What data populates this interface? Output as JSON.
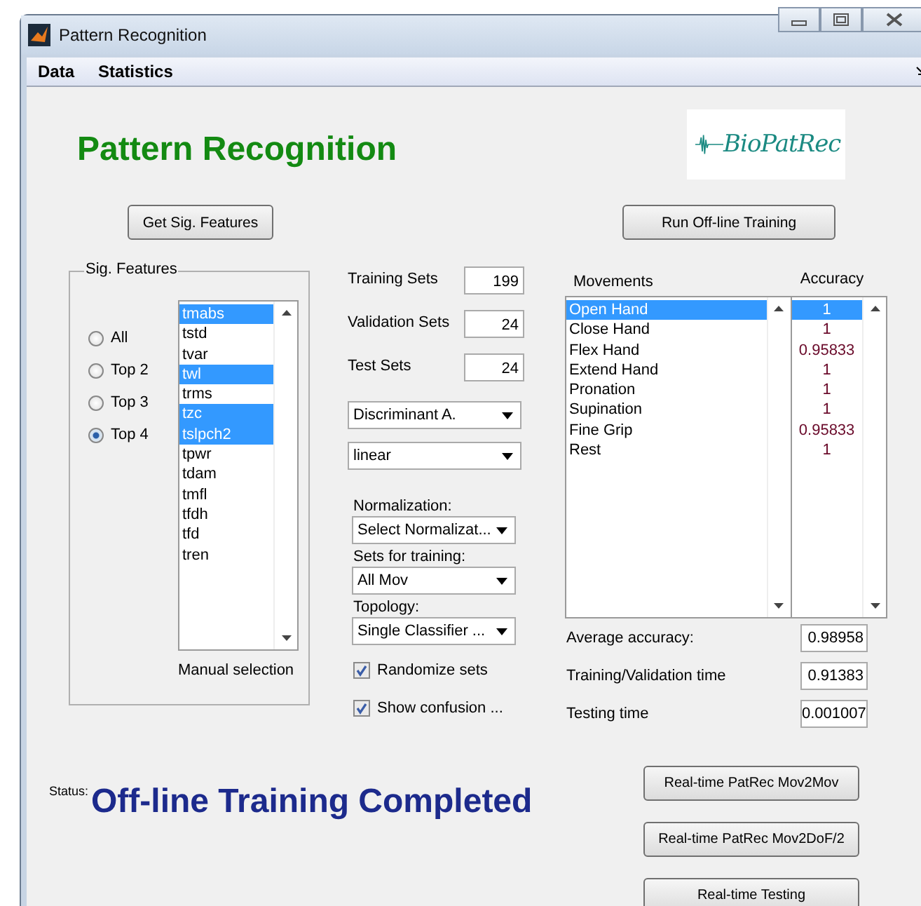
{
  "window": {
    "title": "Pattern Recognition"
  },
  "menu": [
    {
      "label": "Data"
    },
    {
      "label": "Statistics"
    }
  ],
  "header": {
    "title": "Pattern Recognition",
    "logo": "BioPatRec"
  },
  "top_buttons": [
    {
      "label": "Get Sig. Features"
    },
    {
      "label": "Run Off-line Training"
    }
  ],
  "sig_features": {
    "title": "Sig. Features",
    "options": [
      {
        "label": "All",
        "selected": false
      },
      {
        "label": "Top 2",
        "selected": false
      },
      {
        "label": "Top 3",
        "selected": false
      },
      {
        "label": "Top 4",
        "selected": true
      }
    ],
    "features": [
      {
        "label": "tmabs",
        "selected": true
      },
      {
        "label": "tstd",
        "selected": false
      },
      {
        "label": "tvar",
        "selected": false
      },
      {
        "label": "twl",
        "selected": true
      },
      {
        "label": "trms",
        "selected": false
      },
      {
        "label": "tzc",
        "selected": true
      },
      {
        "label": "tslpch2",
        "selected": true
      },
      {
        "label": "tpwr",
        "selected": false
      },
      {
        "label": "tdam",
        "selected": false
      },
      {
        "label": "tmfl",
        "selected": false
      },
      {
        "label": "tfdh",
        "selected": false
      },
      {
        "label": "tfd",
        "selected": false
      },
      {
        "label": "tren",
        "selected": false
      }
    ],
    "caption": "Manual selection"
  },
  "sets": [
    {
      "label": "Training Sets",
      "value": "199"
    },
    {
      "label": "Validation Sets",
      "value": "24"
    },
    {
      "label": "Test Sets",
      "value": "24"
    }
  ],
  "classifier": [
    {
      "value": "Discriminant A."
    },
    {
      "value": "linear"
    }
  ],
  "dropdowns": [
    {
      "label": "Normalization:",
      "value": "Select Normalizat..."
    },
    {
      "label": "Sets for training:",
      "value": "All Mov"
    },
    {
      "label": "Topology:",
      "value": "Single Classifier ..."
    }
  ],
  "checkboxes": [
    {
      "label": "Randomize sets",
      "checked": true
    },
    {
      "label": "Show confusion ...",
      "checked": true
    }
  ],
  "results": {
    "movements_header": "Movements",
    "accuracy_header": "Accuracy",
    "rows": [
      {
        "movement": "Open Hand",
        "accuracy": "1",
        "selected": true
      },
      {
        "movement": "Close Hand",
        "accuracy": "1",
        "selected": false
      },
      {
        "movement": "Flex Hand",
        "accuracy": "0.95833",
        "selected": false
      },
      {
        "movement": "Extend Hand",
        "accuracy": "1",
        "selected": false
      },
      {
        "movement": "Pronation",
        "accuracy": "1",
        "selected": false
      },
      {
        "movement": "Supination",
        "accuracy": "1",
        "selected": false
      },
      {
        "movement": "Fine Grip",
        "accuracy": "0.95833",
        "selected": false
      },
      {
        "movement": "Rest",
        "accuracy": "1",
        "selected": false
      }
    ]
  },
  "metrics": [
    {
      "label": "Average accuracy:",
      "value": "0.98958"
    },
    {
      "label": "Training/Validation time",
      "value": "0.91383"
    },
    {
      "label": "Testing time",
      "value": "0.001007"
    }
  ],
  "status": {
    "label": "Status:",
    "message": "Off-line Training Completed"
  },
  "realtime_buttons": [
    {
      "label": "Real-time PatRec Mov2Mov"
    },
    {
      "label": "Real-time PatRec Mov2DoF/2"
    },
    {
      "label": "Real-time Testing"
    }
  ]
}
